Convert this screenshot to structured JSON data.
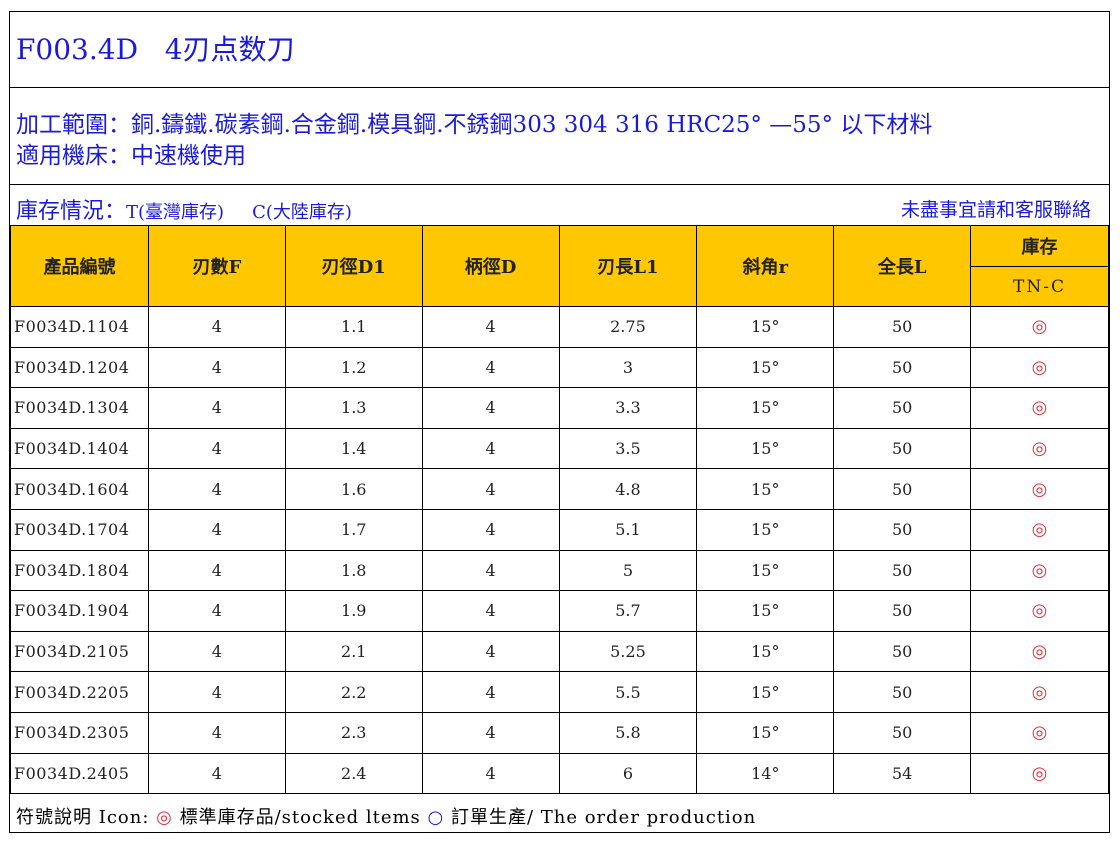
{
  "title": "F003.4D   4刃点数刀",
  "scope_line1": "加工範圍：銅.鑄鐵.碳素鋼.合金鋼.模具鋼.不銹鋼303 304 316 HRC25° —55° 以下材料",
  "scope_line2": "適用機床：中速機使用",
  "stock_label": "庫存情況：",
  "stock_t": "T(臺灣庫存)",
  "stock_c": "C(大陸庫存)",
  "stock_note": "未盡事宜請和客服聯絡",
  "headers": {
    "code": "產品編號",
    "flutes": "刃數F",
    "d1": "刃徑D1",
    "d": "柄徑D",
    "l1": "刃長L1",
    "angle": "斜角r",
    "length": "全長L",
    "stock": "庫存",
    "stock_sub": "TN-C"
  },
  "rows": [
    {
      "code": "F0034D.1104",
      "flutes": "4",
      "d1": "1.1",
      "d": "4",
      "l1": "2.75",
      "angle": "15°",
      "length": "50",
      "stock": "◎"
    },
    {
      "code": "F0034D.1204",
      "flutes": "4",
      "d1": "1.2",
      "d": "4",
      "l1": "3",
      "angle": "15°",
      "length": "50",
      "stock": "◎"
    },
    {
      "code": "F0034D.1304",
      "flutes": "4",
      "d1": "1.3",
      "d": "4",
      "l1": "3.3",
      "angle": "15°",
      "length": "50",
      "stock": "◎"
    },
    {
      "code": "F0034D.1404",
      "flutes": "4",
      "d1": "1.4",
      "d": "4",
      "l1": "3.5",
      "angle": "15°",
      "length": "50",
      "stock": "◎"
    },
    {
      "code": "F0034D.1604",
      "flutes": "4",
      "d1": "1.6",
      "d": "4",
      "l1": "4.8",
      "angle": "15°",
      "length": "50",
      "stock": "◎"
    },
    {
      "code": "F0034D.1704",
      "flutes": "4",
      "d1": "1.7",
      "d": "4",
      "l1": "5.1",
      "angle": "15°",
      "length": "50",
      "stock": "◎"
    },
    {
      "code": "F0034D.1804",
      "flutes": "4",
      "d1": "1.8",
      "d": "4",
      "l1": "5",
      "angle": "15°",
      "length": "50",
      "stock": "◎"
    },
    {
      "code": "F0034D.1904",
      "flutes": "4",
      "d1": "1.9",
      "d": "4",
      "l1": "5.7",
      "angle": "15°",
      "length": "50",
      "stock": "◎"
    },
    {
      "code": "F0034D.2105",
      "flutes": "4",
      "d1": "2.1",
      "d": "4",
      "l1": "5.25",
      "angle": "15°",
      "length": "50",
      "stock": "◎"
    },
    {
      "code": "F0034D.2205",
      "flutes": "4",
      "d1": "2.2",
      "d": "4",
      "l1": "5.5",
      "angle": "15°",
      "length": "50",
      "stock": "◎"
    },
    {
      "code": "F0034D.2305",
      "flutes": "4",
      "d1": "2.3",
      "d": "4",
      "l1": "5.8",
      "angle": "15°",
      "length": "50",
      "stock": "◎"
    },
    {
      "code": "F0034D.2405",
      "flutes": "4",
      "d1": "2.4",
      "d": "4",
      "l1": "6",
      "angle": "14°",
      "length": "54",
      "stock": "◎"
    }
  ],
  "legend": {
    "prefix": "符號說明 Icon: ",
    "stocked_mark": "◎",
    "stocked_text": " 標準庫存品/stocked ltems ",
    "order_mark": "○",
    "order_text": " 訂單生產/ The order production"
  },
  "colors": {
    "header_bg": "#ffc700",
    "blue_text": "#1a1adb",
    "red_mark": "#e8333d"
  }
}
